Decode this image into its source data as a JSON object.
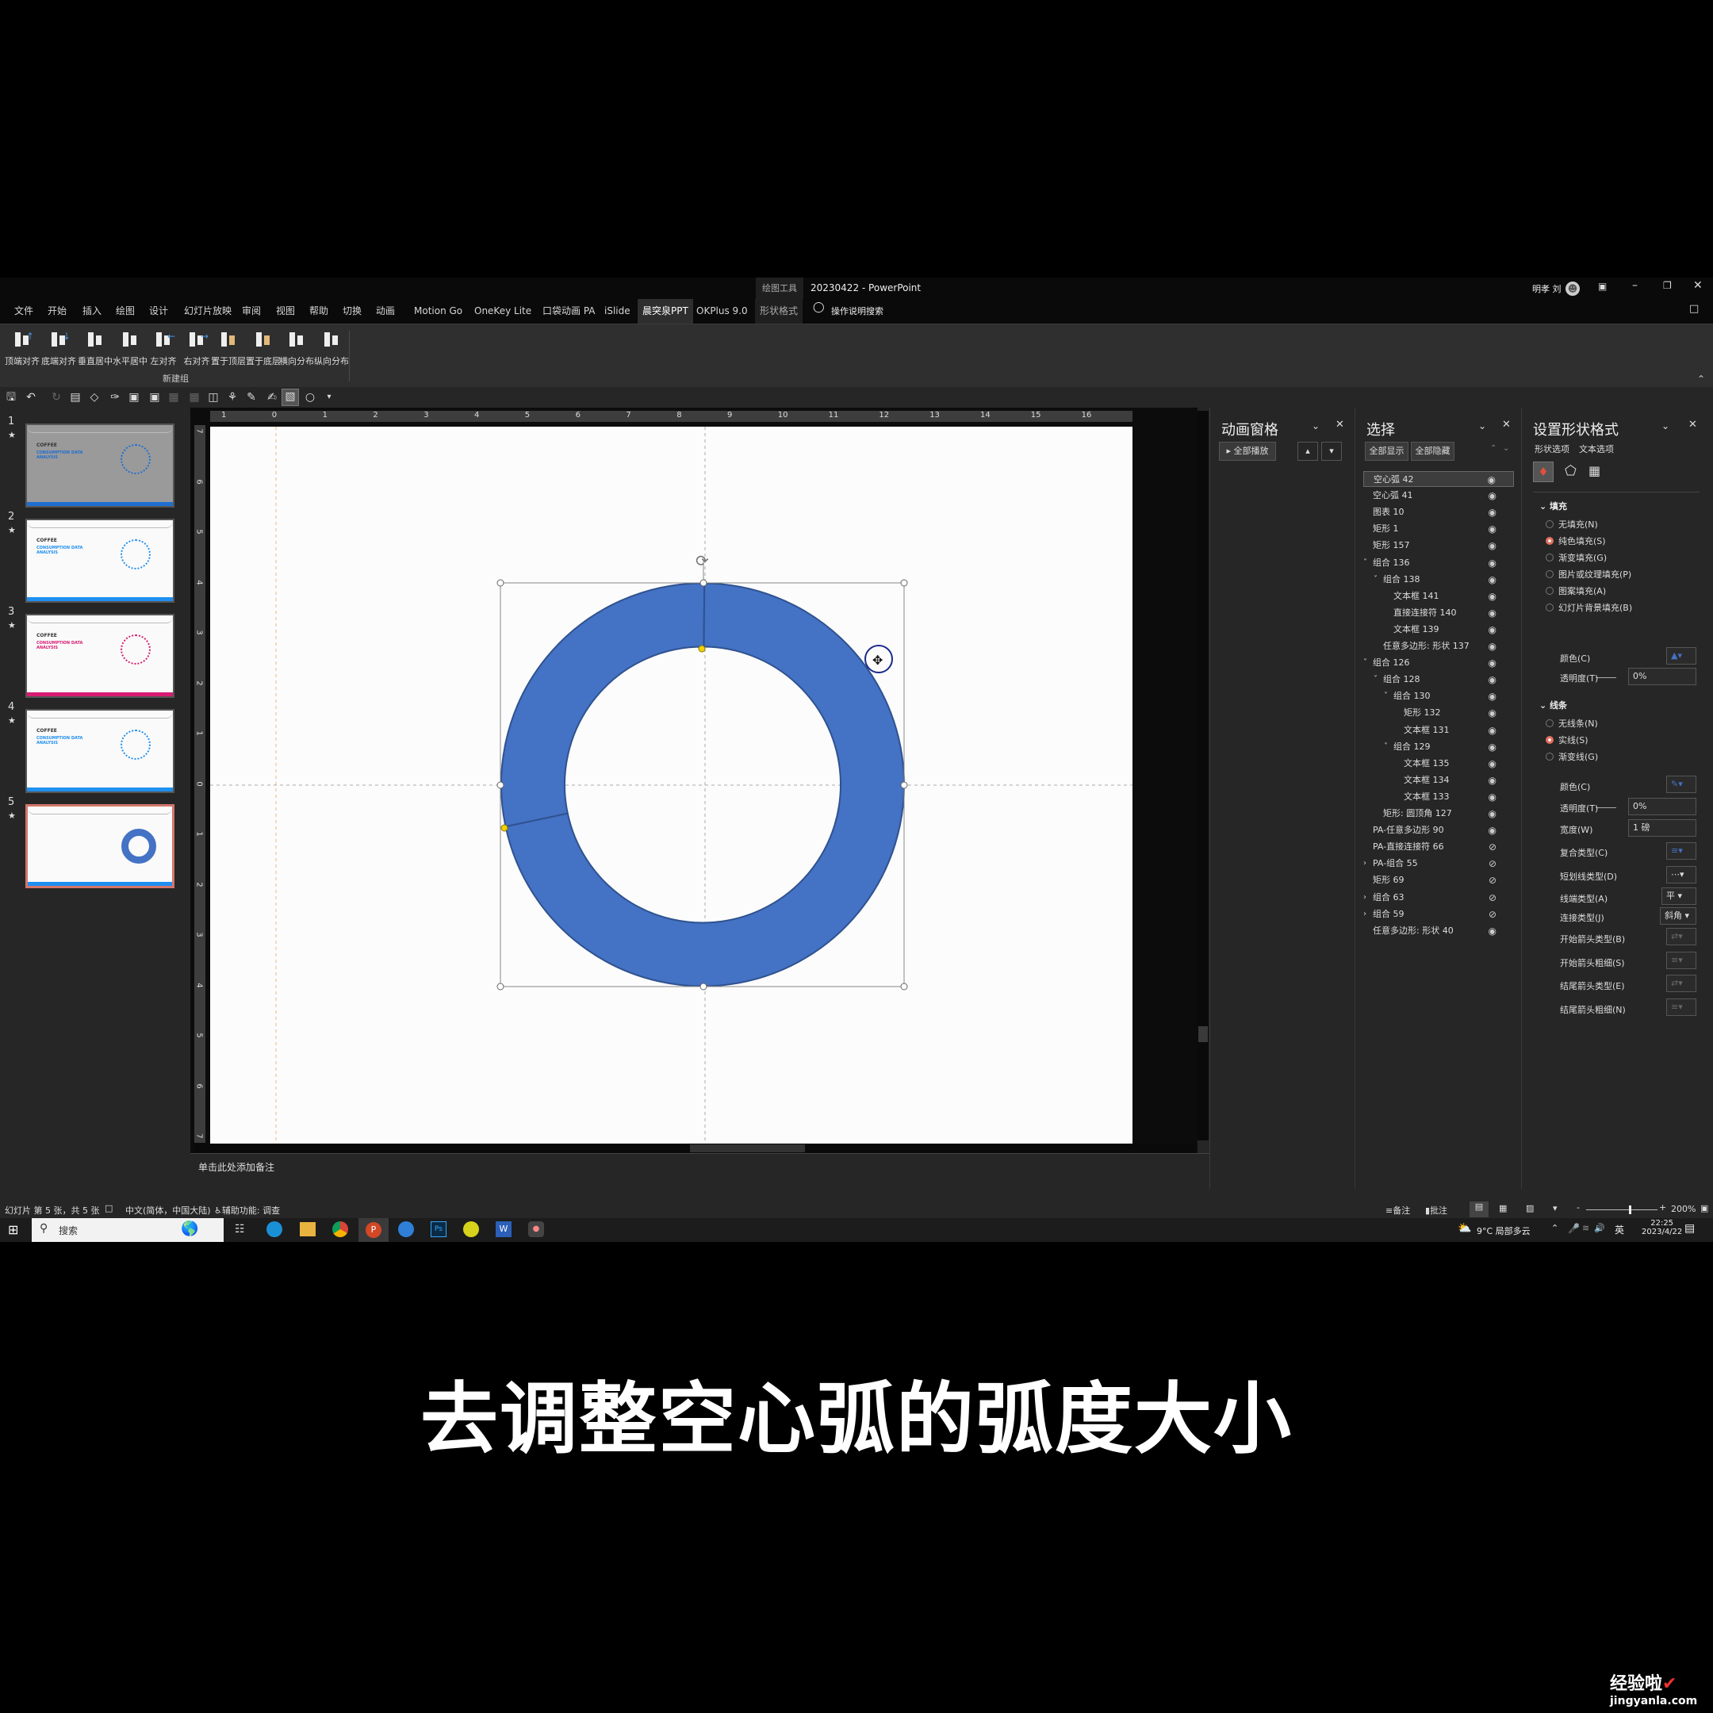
{
  "window": {
    "title": "20230422 - PowerPoint",
    "context_group": "绘图工具",
    "user_name": "明孝 刘",
    "search_hint": "操作说明搜索"
  },
  "menu_tabs": [
    "文件",
    "开始",
    "插入",
    "绘图",
    "设计",
    "幻灯片放映",
    "审阅",
    "视图",
    "帮助",
    "切换",
    "动画",
    "Motion Go",
    "OneKey Lite",
    "口袋动画 PA",
    "iSlide",
    "晨突泉PPT",
    "OKPlus 9.0",
    "形状格式"
  ],
  "active_tab": "晨突泉PPT",
  "ribbon": {
    "buttons": [
      "顶端对齐",
      "底端对齐",
      "垂直居中",
      "水平居中",
      "左对齐",
      "右对齐",
      "置于顶层",
      "置于底层",
      "横向分布",
      "纵向分布"
    ],
    "group_label": "新建组"
  },
  "slides": [
    {
      "number": "1",
      "title": "COFFEE",
      "subtitle": "CONSUMPTION DATA ANALYSIS"
    },
    {
      "number": "2",
      "title": "COFFEE",
      "subtitle": "CONSUMPTION DATA ANALYSIS"
    },
    {
      "number": "3",
      "title": "COFFEE",
      "subtitle": "CONSUMPTION DATA ANALYSIS"
    },
    {
      "number": "4",
      "title": "COFFEE",
      "subtitle": "CONSUMPTION DATA ANALYSIS"
    },
    {
      "number": "5",
      "title": "",
      "subtitle": ""
    }
  ],
  "selected_slide": 5,
  "ruler": {
    "horizontal": [
      "1",
      "0",
      "1",
      "2",
      "3",
      "4",
      "5",
      "6",
      "7",
      "8",
      "9",
      "10",
      "11",
      "12",
      "13",
      "14",
      "15",
      "16"
    ],
    "vertical": [
      "7",
      "6",
      "5",
      "4",
      "3",
      "2",
      "1",
      "0",
      "1",
      "2",
      "3",
      "4",
      "5",
      "6",
      "7"
    ]
  },
  "shape": {
    "type": "block-arc",
    "fill_color": "#4472c4",
    "stroke_color": "#2f528f"
  },
  "notes_placeholder": "单击此处添加备注",
  "animation_pane": {
    "title": "动画窗格",
    "play_all": "全部播放"
  },
  "selection_pane": {
    "title": "选择",
    "show_all": "全部显示",
    "hide_all": "全部隐藏",
    "items": [
      {
        "label": "空心弧 42",
        "level": 0,
        "expand": "",
        "visible": true,
        "selected": true
      },
      {
        "label": "空心弧 41",
        "level": 0,
        "expand": "",
        "visible": true
      },
      {
        "label": "图表 10",
        "level": 0,
        "expand": "",
        "visible": true
      },
      {
        "label": "矩形 1",
        "level": 0,
        "expand": "",
        "visible": true
      },
      {
        "label": "矩形 157",
        "level": 0,
        "expand": "",
        "visible": true
      },
      {
        "label": "组合 136",
        "level": 0,
        "expand": "open",
        "visible": true
      },
      {
        "label": "组合 138",
        "level": 1,
        "expand": "open",
        "visible": true
      },
      {
        "label": "文本框 141",
        "level": 2,
        "expand": "",
        "visible": true
      },
      {
        "label": "直接连接符 140",
        "level": 2,
        "expand": "",
        "visible": true
      },
      {
        "label": "文本框 139",
        "level": 2,
        "expand": "",
        "visible": true
      },
      {
        "label": "任意多边形: 形状 137",
        "level": 1,
        "expand": "",
        "visible": true
      },
      {
        "label": "组合 126",
        "level": 0,
        "expand": "open",
        "visible": true
      },
      {
        "label": "组合 128",
        "level": 1,
        "expand": "open",
        "visible": true
      },
      {
        "label": "组合 130",
        "level": 2,
        "expand": "open",
        "visible": true
      },
      {
        "label": "矩形 132",
        "level": 3,
        "expand": "",
        "visible": true
      },
      {
        "label": "文本框 131",
        "level": 3,
        "expand": "",
        "visible": true
      },
      {
        "label": "组合 129",
        "level": 2,
        "expand": "open",
        "visible": true
      },
      {
        "label": "文本框 135",
        "level": 3,
        "expand": "",
        "visible": true
      },
      {
        "label": "文本框 134",
        "level": 3,
        "expand": "",
        "visible": true
      },
      {
        "label": "文本框 133",
        "level": 3,
        "expand": "",
        "visible": true
      },
      {
        "label": "矩形: 圆顶角 127",
        "level": 1,
        "expand": "",
        "visible": true
      },
      {
        "label": "PA-任意多边形 90",
        "level": 0,
        "expand": "",
        "visible": true
      },
      {
        "label": "PA-直接连接符 66",
        "level": 0,
        "expand": "",
        "visible": false
      },
      {
        "label": "PA-组合 55",
        "level": 0,
        "expand": "closed",
        "visible": false
      },
      {
        "label": "矩形 69",
        "level": 0,
        "expand": "",
        "visible": false
      },
      {
        "label": "组合 63",
        "level": 0,
        "expand": "closed",
        "visible": false
      },
      {
        "label": "组合 59",
        "level": 0,
        "expand": "closed",
        "visible": false
      },
      {
        "label": "任意多边形: 形状 40",
        "level": 0,
        "expand": "",
        "visible": true
      }
    ]
  },
  "format_pane": {
    "title": "设置形状格式",
    "tabs": [
      "形状选项",
      "文本选项"
    ],
    "fill": {
      "heading": "填充",
      "options": [
        "无填充(N)",
        "纯色填充(S)",
        "渐变填充(G)",
        "图片或纹理填充(P)",
        "图案填充(A)",
        "幻灯片背景填充(B)"
      ],
      "selected": 1,
      "color_label": "颜色(C)",
      "transparency_label": "透明度(T)",
      "transparency_value": "0%"
    },
    "line": {
      "heading": "线条",
      "options": [
        "无线条(N)",
        "实线(S)",
        "渐变线(G)"
      ],
      "selected": 1,
      "color_label": "颜色(C)",
      "transparency_label": "透明度(T)",
      "transparency_value": "0%",
      "width_label": "宽度(W)",
      "width_value": "1 磅",
      "compound_label": "复合类型(C)",
      "dash_label": "短划线类型(D)",
      "cap_label": "线端类型(A)",
      "cap_value": "平",
      "join_label": "连接类型(J)",
      "join_value": "斜角",
      "begin_arrow_type": "开始箭头类型(B)",
      "begin_arrow_size": "开始箭头粗细(S)",
      "end_arrow_type": "结尾箭头类型(E)",
      "end_arrow_size": "结尾箭头粗细(N)"
    }
  },
  "status_bar": {
    "slide_info": "幻灯片 第 5 张，共 5 张",
    "language": "中文(简体，中国大陆)",
    "accessibility": "辅助功能: 调查",
    "notes": "备注",
    "comments": "批注",
    "zoom": "200%",
    "zoom_fraction": 0.6
  },
  "taskbar": {
    "search_placeholder": "搜索",
    "weather": "9°C 局部多云",
    "ime": "英",
    "time": "22:25",
    "date": "2023/4/22"
  },
  "caption": "去调整空心弧的弧度大小",
  "watermark": {
    "line1": "经验啦",
    "line2": "jingyanla.com"
  }
}
